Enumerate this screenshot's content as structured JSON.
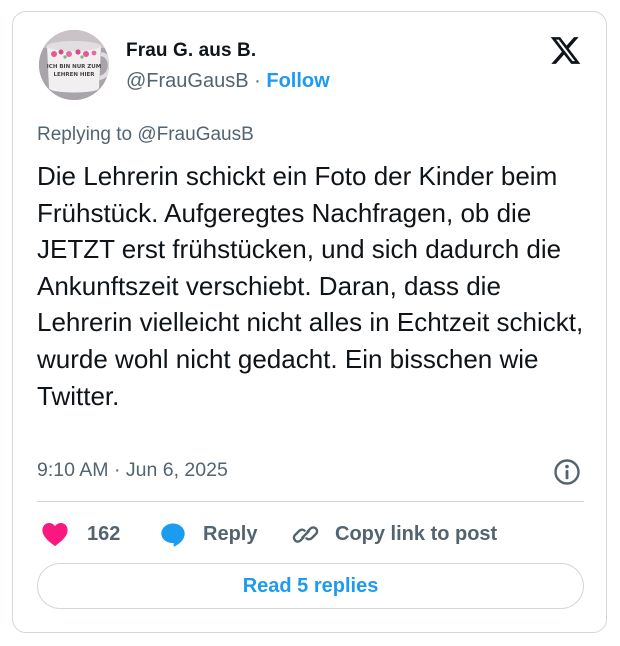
{
  "author": {
    "name": "Frau G. aus B.",
    "handle": "@FrauGausB",
    "separator": "·",
    "follow_label": "Follow"
  },
  "avatar": {
    "mug_text": "ICH BIN NUR ZUM LEHREN HIER"
  },
  "replying_to": "Replying to @FrauGausB",
  "body": "Die Lehrerin schickt ein Foto der Kinder beim Frühstück. Aufgeregtes Nachfragen, ob die JETZT erst frühstücken, und sich dadurch die Ankunftszeit verschiebt. Daran, dass die Lehrerin vielleicht nicht alles in Echtzeit schickt, wurde wohl nicht gedacht. Ein bisschen wie Twitter.",
  "timestamp": "9:10 AM · Jun 6, 2025",
  "actions": {
    "like_count": "162",
    "reply_label": "Reply",
    "copy_label": "Copy link to post"
  },
  "read_replies_label": "Read 5 replies",
  "colors": {
    "accent": "#1d9bf0",
    "like": "#f91880",
    "text": "#0f1419",
    "secondary": "#536471",
    "border": "#cfd9de"
  },
  "icons": [
    "x-logo-icon",
    "info-icon",
    "heart-icon",
    "reply-bubble-icon",
    "link-icon"
  ]
}
